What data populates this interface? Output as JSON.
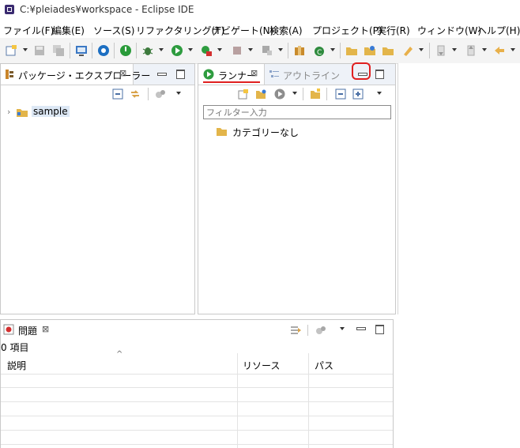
{
  "window": {
    "title": "C:¥pleiades¥workspace - Eclipse IDE"
  },
  "menu": [
    "ファイル(F)",
    "編集(E)",
    "ソース(S)",
    "リファクタリング(T)",
    "ナビゲート(N)",
    "検索(A)",
    "プロジェクト(P)",
    "実行(R)",
    "ウィンドウ(W)",
    "ヘルプ(H)"
  ],
  "package_explorer": {
    "tab_label": "パッケージ・エクスプローラー",
    "tree": [
      {
        "label": "sample"
      }
    ]
  },
  "runner": {
    "tab_label": "ランナー",
    "inactive_tab_label": "アウトライン",
    "filter_placeholder": "フィルター入力",
    "tree": [
      {
        "label": "カテゴリーなし"
      }
    ]
  },
  "problems": {
    "tab_label": "問題",
    "count_text": "0 項目",
    "columns": [
      "説明",
      "リソース",
      "パス"
    ],
    "rows": []
  },
  "annotations": {
    "highlight_color": "#e02020",
    "underline_target": "runner-tab",
    "circle_target": "runner-minimize-button"
  }
}
